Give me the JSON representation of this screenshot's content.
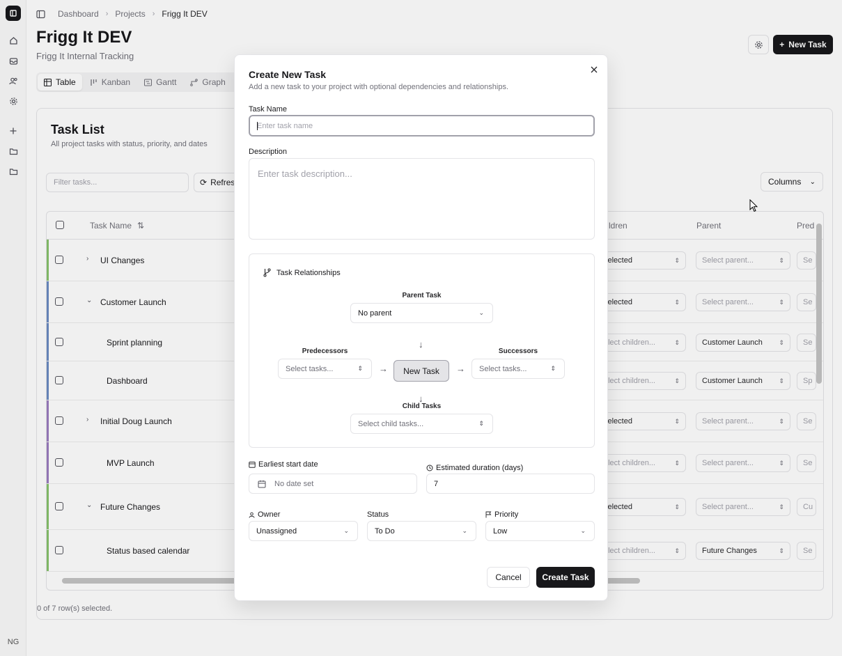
{
  "rail": {
    "initials": "NG"
  },
  "breadcrumb": [
    "Dashboard",
    "Projects",
    "Frigg It DEV"
  ],
  "project": {
    "title": "Frigg It DEV",
    "subtitle": "Frigg It Internal Tracking"
  },
  "header_actions": {
    "new_task": "New Task"
  },
  "view_tabs": [
    "Table",
    "Kanban",
    "Gantt",
    "Graph"
  ],
  "task_list": {
    "title": "Task List",
    "subtitle": "All project tasks with status, priority, and dates",
    "filter_placeholder": "Filter tasks...",
    "refresh": "Refresh",
    "columns": "Columns",
    "headers": {
      "task_name": "Task Name",
      "children": "ldren",
      "parent": "Parent",
      "pred": "Pred"
    },
    "rows": [
      {
        "name": "UI Changes",
        "children": "selected",
        "parent": "Select parent...",
        "pred": "Se",
        "color": "#86c26b",
        "chevron": "›"
      },
      {
        "name": "Customer Launch",
        "children": "selected",
        "parent": "Select parent...",
        "pred": "Se",
        "color": "#6b8bc2",
        "chevron": "⌄"
      },
      {
        "name": "Sprint planning",
        "children": "elect children...",
        "parent": "Customer Launch",
        "pred": "Se",
        "color": "#6b8bc2",
        "chevron": ""
      },
      {
        "name": "Dashboard",
        "children": "elect children...",
        "parent": "Customer Launch",
        "pred": "Sp",
        "color": "#6b8bc2",
        "chevron": ""
      },
      {
        "name": "Initial Doug Launch",
        "children": "selected",
        "parent": "Select parent...",
        "pred": "Se",
        "color": "#9b7cbf",
        "chevron": "›"
      },
      {
        "name": "MVP Launch",
        "children": "elect children...",
        "parent": "Select parent...",
        "pred": "Se",
        "color": "#9b7cbf",
        "chevron": ""
      },
      {
        "name": "Future Changes",
        "children": "selected",
        "parent": "Select parent...",
        "pred": "Cu",
        "color": "#86c26b",
        "chevron": "⌄"
      },
      {
        "name": "Status based calendar",
        "children": "elect children...",
        "parent": "Future Changes",
        "pred": "Se",
        "color": "#86c26b",
        "chevron": ""
      }
    ],
    "row_count": "0 of 7 row(s) selected."
  },
  "modal": {
    "title": "Create New Task",
    "description": "Add a new task to your project with optional dependencies and relationships.",
    "task_name_label": "Task Name",
    "task_name_placeholder": "Enter task name",
    "description_label": "Description",
    "description_placeholder": "Enter task description...",
    "relationships": {
      "title": "Task Relationships",
      "parent_label": "Parent Task",
      "parent_value": "No parent",
      "predecessors_label": "Predecessors",
      "predecessors_placeholder": "Select tasks...",
      "node": "New Task",
      "successors_label": "Successors",
      "successors_placeholder": "Select tasks...",
      "children_label": "Child Tasks",
      "children_placeholder": "Select child tasks..."
    },
    "start_date_label": "Earliest start date",
    "start_date_value": "No date set",
    "duration_label": "Estimated duration (days)",
    "duration_value": "7",
    "owner_label": "Owner",
    "owner_value": "Unassigned",
    "status_label": "Status",
    "status_value": "To Do",
    "priority_label": "Priority",
    "priority_value": "Low",
    "cancel": "Cancel",
    "create": "Create Task"
  }
}
